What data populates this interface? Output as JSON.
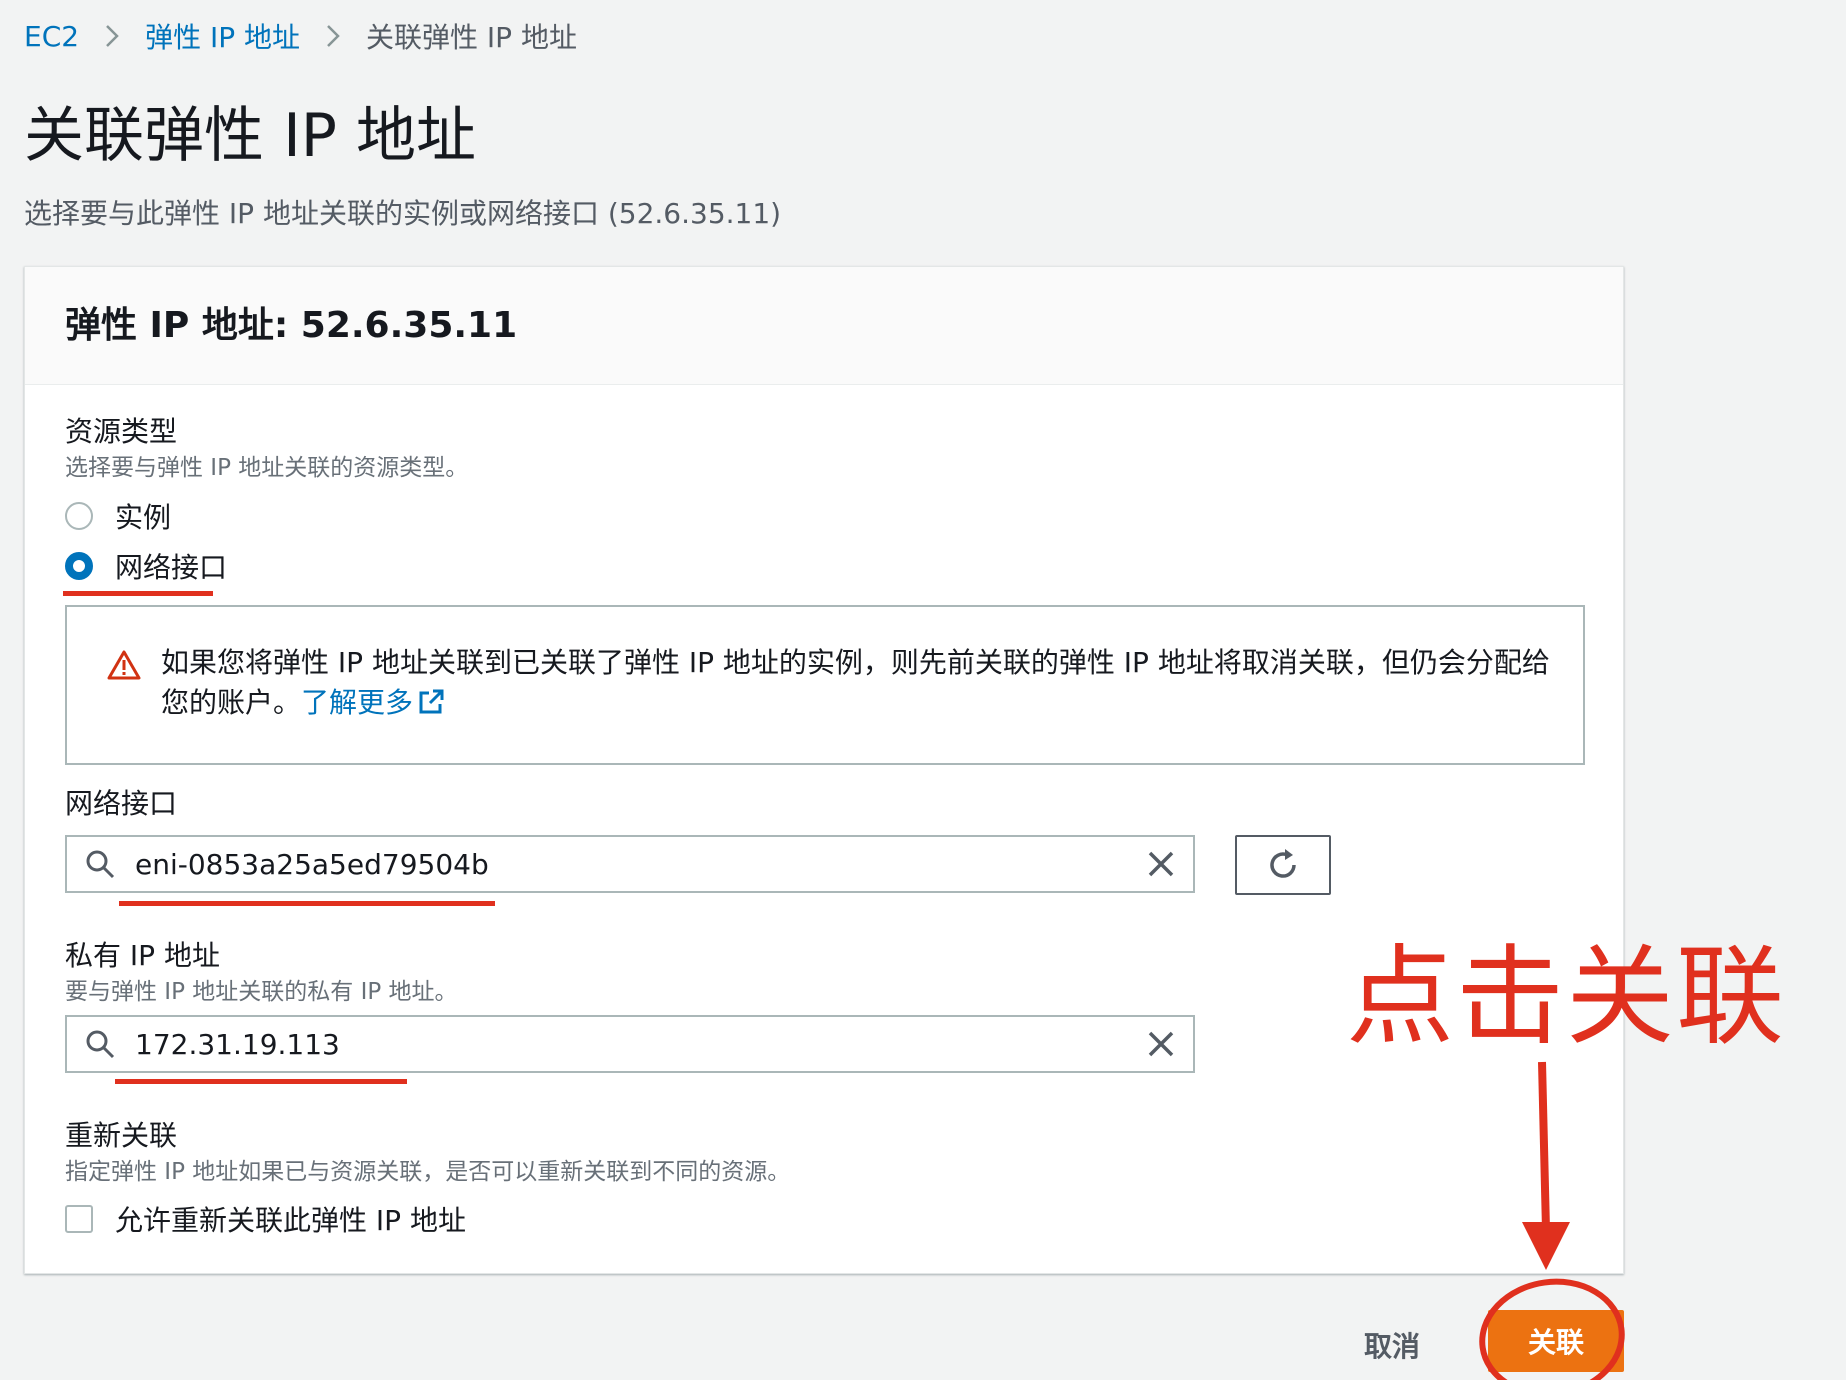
{
  "breadcrumb": {
    "items": [
      "EC2",
      "弹性 IP 地址",
      "关联弹性 IP 地址"
    ]
  },
  "page": {
    "title": "关联弹性 IP 地址",
    "description": "选择要与此弹性 IP 地址关联的实例或网络接口 (52.6.35.11)"
  },
  "panel": {
    "title": "弹性 IP 地址: 52.6.35.11"
  },
  "resource_type": {
    "label": "资源类型",
    "description": "选择要与弹性 IP 地址关联的资源类型。",
    "options": [
      {
        "label": "实例",
        "selected": false
      },
      {
        "label": "网络接口",
        "selected": true
      }
    ]
  },
  "alert": {
    "text": "如果您将弹性 IP 地址关联到已关联了弹性 IP 地址的实例，则先前关联的弹性 IP 地址将取消关联，但仍会分配给您的账户。",
    "link": "了解更多",
    "icon": "warning-icon"
  },
  "network_interface": {
    "label": "网络接口",
    "value": "eni-0853a25a5ed79504b"
  },
  "private_ip": {
    "label": "私有 IP 地址",
    "description": "要与弹性 IP 地址关联的私有 IP 地址。",
    "value": "172.31.19.113"
  },
  "reassociation": {
    "label": "重新关联",
    "description": "指定弹性 IP 地址如果已与资源关联，是否可以重新关联到不同的资源。",
    "checkbox_label": "允许重新关联此弹性 IP 地址",
    "checked": false
  },
  "annotation": {
    "text": "点击关联",
    "color": "#e0301e"
  },
  "footer": {
    "cancel_label": "取消",
    "associate_label": "关联"
  },
  "colors": {
    "link": "#0073bb",
    "primary_button": "#ec7211",
    "radio_selected": "#0073bb",
    "annotation_red": "#e0301e"
  }
}
